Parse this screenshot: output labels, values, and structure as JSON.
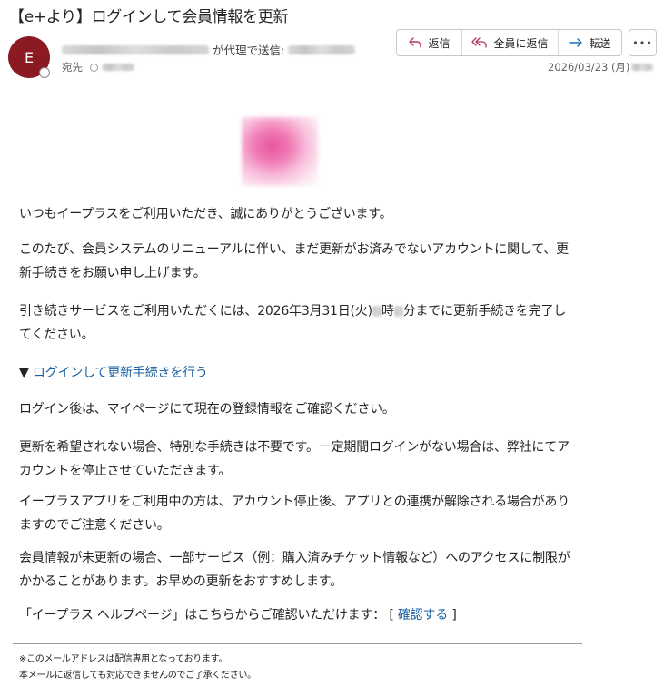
{
  "email": {
    "subject": "【e+より】ログインして会員情報を更新",
    "avatar_initial": "E",
    "on_behalf_label": "が代理で送信:",
    "to_label": "宛先",
    "date": "2026/03/23 (月)"
  },
  "actions": {
    "reply": "返信",
    "reply_all": "全員に返信",
    "forward": "転送",
    "more": "•••"
  },
  "body": {
    "greeting": "いつもイープラスをご利用いただき、誠にありがとうございます。",
    "para1": "このたび、会員システムのリニューアルに伴い、まだ更新がお済みでないアカウントに関して、更新手続きをお願い申し上げます。",
    "para2_before": "引き続きサービスをご利用いただくには、2026年3月31日(火)",
    "para2_hour_suffix": "時",
    "para2_after": "分までに更新手続きを完了してください。",
    "login_arrow": "▼",
    "login_link": "ログインして更新手続きを行う",
    "para3": "ログイン後は、マイページにて現在の登録情報をご確認ください。",
    "para4": "更新を希望されない場合、特別な手続きは不要です。一定期間ログインがない場合は、弊社にてアカウントを停止させていただきます。",
    "para5": "イープラスアプリをご利用中の方は、アカウント停止後、アプリとの連携が解除される場合がありますのでご注意ください。",
    "para6": "会員情報が未更新の場合、一部サービス（例：購入済みチケット情報など）へのアクセスに制限がかかることがあります。お早めの更新をおすすめします。",
    "help_text": "「イープラス ヘルプページ」はこちらからご確認いただけます：",
    "help_bracket_open": "[",
    "help_link": "確認する",
    "help_bracket_close": "]"
  },
  "footer": {
    "line1": "※このメールアドレスは配信専用となっております。",
    "line2": "本メールに返信しても対応できませんのでご了承ください。"
  },
  "colors": {
    "avatar": "#8b1a22",
    "link": "#1a5fa0",
    "reply_icon": "#b4316a",
    "forward_icon": "#1f6fb3"
  }
}
